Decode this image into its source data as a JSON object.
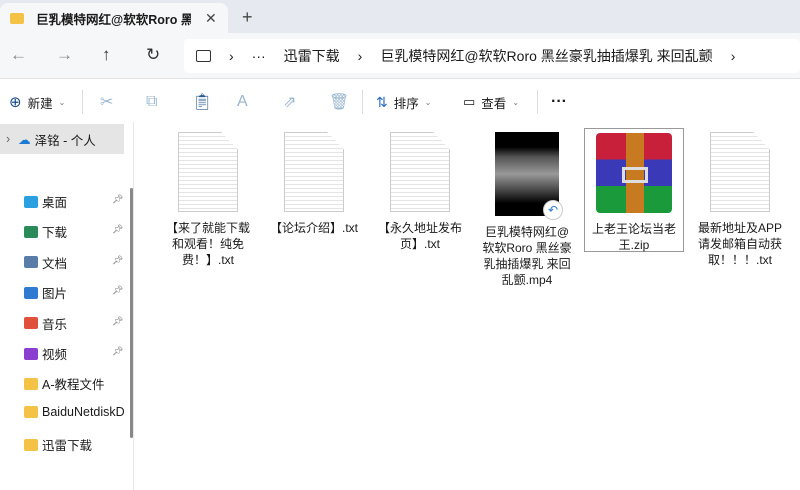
{
  "tab": {
    "title": "巨乳模特网红@软软Roro 黑丝豪乳抽插爆乳 来回乱颤",
    "close": "✕",
    "new": "+"
  },
  "nav": {
    "back": "←",
    "forward": "→",
    "up": "↑",
    "refresh": "↻"
  },
  "address": {
    "more": "···",
    "crumbs": [
      "迅雷下载",
      "巨乳模特网红@软软Roro 黑丝豪乳抽插爆乳 来回乱颤"
    ],
    "sep": "›"
  },
  "toolbar": {
    "new": "新建",
    "sort": "排序",
    "view": "查看",
    "more": "···"
  },
  "sidebar": {
    "top": "泽铭 - 个人",
    "items": [
      {
        "label": "桌面",
        "color": "#2aa0e0",
        "pinned": true
      },
      {
        "label": "下载",
        "color": "#2a8a5a",
        "pinned": true
      },
      {
        "label": "文档",
        "color": "#5a7ca8",
        "pinned": true
      },
      {
        "label": "图片",
        "color": "#2f7bd1",
        "pinned": true
      },
      {
        "label": "音乐",
        "color": "#e0503a",
        "pinned": true
      },
      {
        "label": "视频",
        "color": "#8a3fd1",
        "pinned": true
      },
      {
        "label": "A-教程文件",
        "color": "#f4c245",
        "pinned": false
      },
      {
        "label": "BaiduNetdiskD",
        "color": "#f4c245",
        "pinned": false
      },
      {
        "label": "迅雷下载",
        "color": "#f4c245",
        "pinned": false
      }
    ]
  },
  "files": [
    {
      "name": "【来了就能下载和观看！纯免费！】.txt",
      "type": "txt"
    },
    {
      "name": "【论坛介绍】.txt",
      "type": "txt"
    },
    {
      "name": "【永久地址发布页】.txt",
      "type": "txt"
    },
    {
      "name": "巨乳模特网红@软软Roro 黑丝豪乳抽插爆乳 来回乱颤.mp4",
      "type": "video"
    },
    {
      "name": "上老王论坛当老王.zip",
      "type": "zip"
    },
    {
      "name": "最新地址及APP请发邮箱自动获取！！！.txt",
      "type": "txt"
    }
  ]
}
